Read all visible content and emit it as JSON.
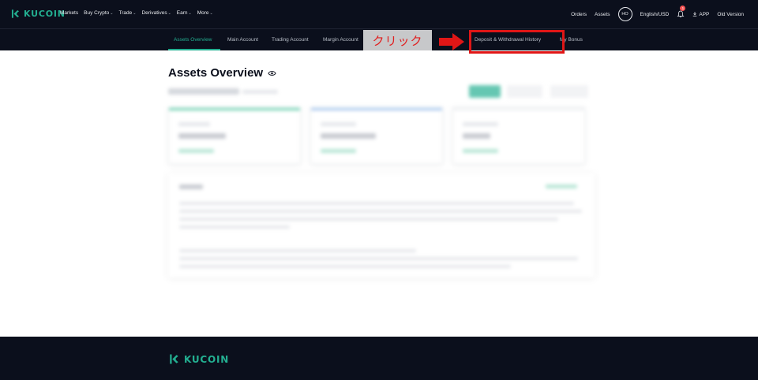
{
  "brand": {
    "name": "KUCOIN",
    "accent": "#23af91",
    "dark": "#0b0f1c"
  },
  "topnav": {
    "items": [
      {
        "label": "Markets",
        "dropdown": false
      },
      {
        "label": "Buy Crypto",
        "dropdown": true
      },
      {
        "label": "Trade",
        "dropdown": true
      },
      {
        "label": "Derivatives",
        "dropdown": true
      },
      {
        "label": "Earn",
        "dropdown": true
      },
      {
        "label": "More",
        "dropdown": true
      }
    ],
    "right": {
      "orders": "Orders",
      "assets": "Assets",
      "avatar_initials": "HO",
      "language": "English/USD",
      "notification_count": "1",
      "app": "APP",
      "old_version": "Old Version"
    }
  },
  "subnav": {
    "tabs": [
      {
        "label": "Assets Overview",
        "active": true
      },
      {
        "label": "Main Account",
        "active": false
      },
      {
        "label": "Trading Account",
        "active": false
      },
      {
        "label": "Margin Account",
        "active": false
      },
      {
        "label": "Deposit & Withdrawal History",
        "active": false
      },
      {
        "label": "My Bonus",
        "active": false
      }
    ]
  },
  "annotation": {
    "click_text": "クリック",
    "color": "#e01616"
  },
  "page": {
    "title": "Assets Overview"
  },
  "footer": {
    "brand": "KUCOIN"
  }
}
